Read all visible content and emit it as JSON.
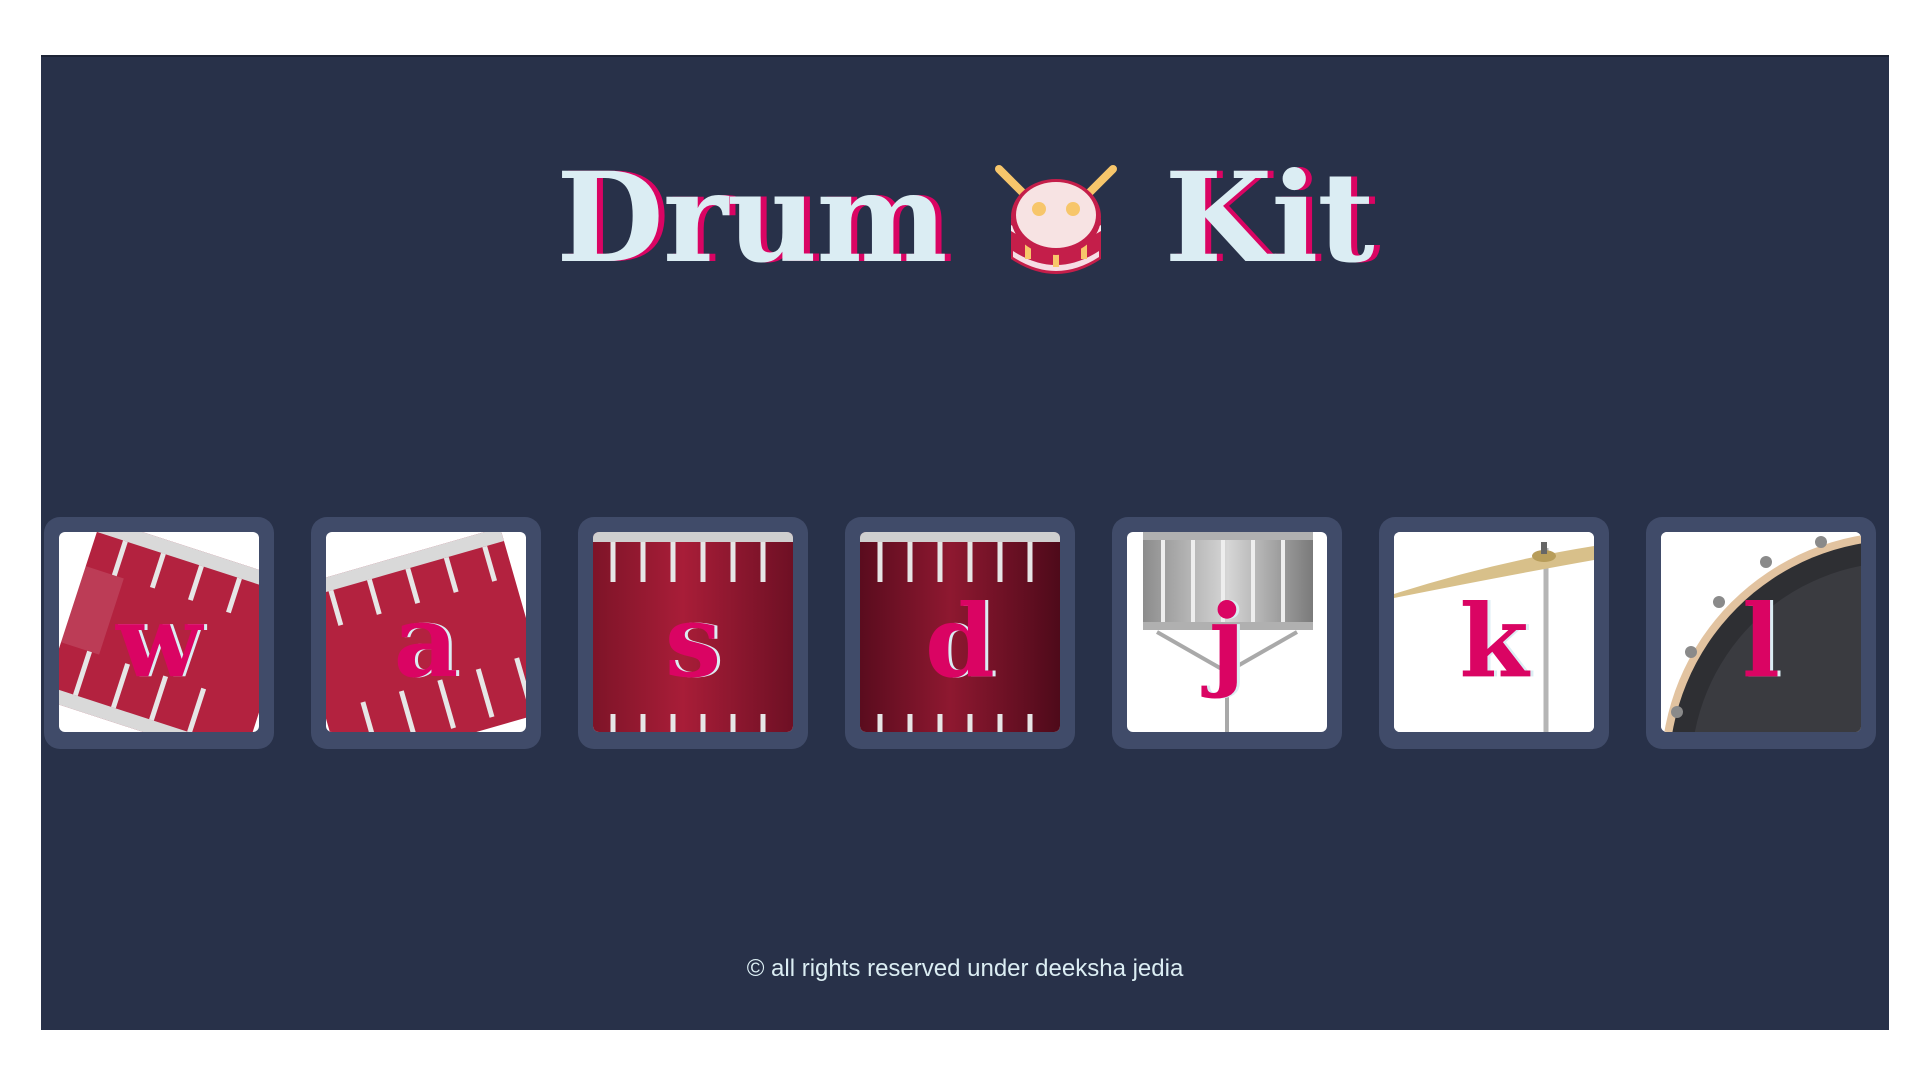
{
  "header": {
    "title_left": "Drum",
    "title_right": "Kit",
    "icon": "drum-icon"
  },
  "drums": [
    {
      "key": "w",
      "image": "tom-tilted-left",
      "name": "tom-1"
    },
    {
      "key": "a",
      "image": "tom-tilted-right",
      "name": "tom-2"
    },
    {
      "key": "s",
      "image": "tom-front",
      "name": "tom-3"
    },
    {
      "key": "d",
      "image": "tom-front-dark",
      "name": "tom-4"
    },
    {
      "key": "j",
      "image": "snare-drum",
      "name": "snare"
    },
    {
      "key": "k",
      "image": "crash-cymbal",
      "name": "crash"
    },
    {
      "key": "l",
      "image": "kick-drum",
      "name": "kick"
    }
  ],
  "footer": {
    "text": "© all rights reserved under deeksha jedia"
  },
  "colors": {
    "background": "#283149",
    "drum_frame": "#404b69",
    "accent": "#da0463",
    "text": "#dbedf3"
  }
}
